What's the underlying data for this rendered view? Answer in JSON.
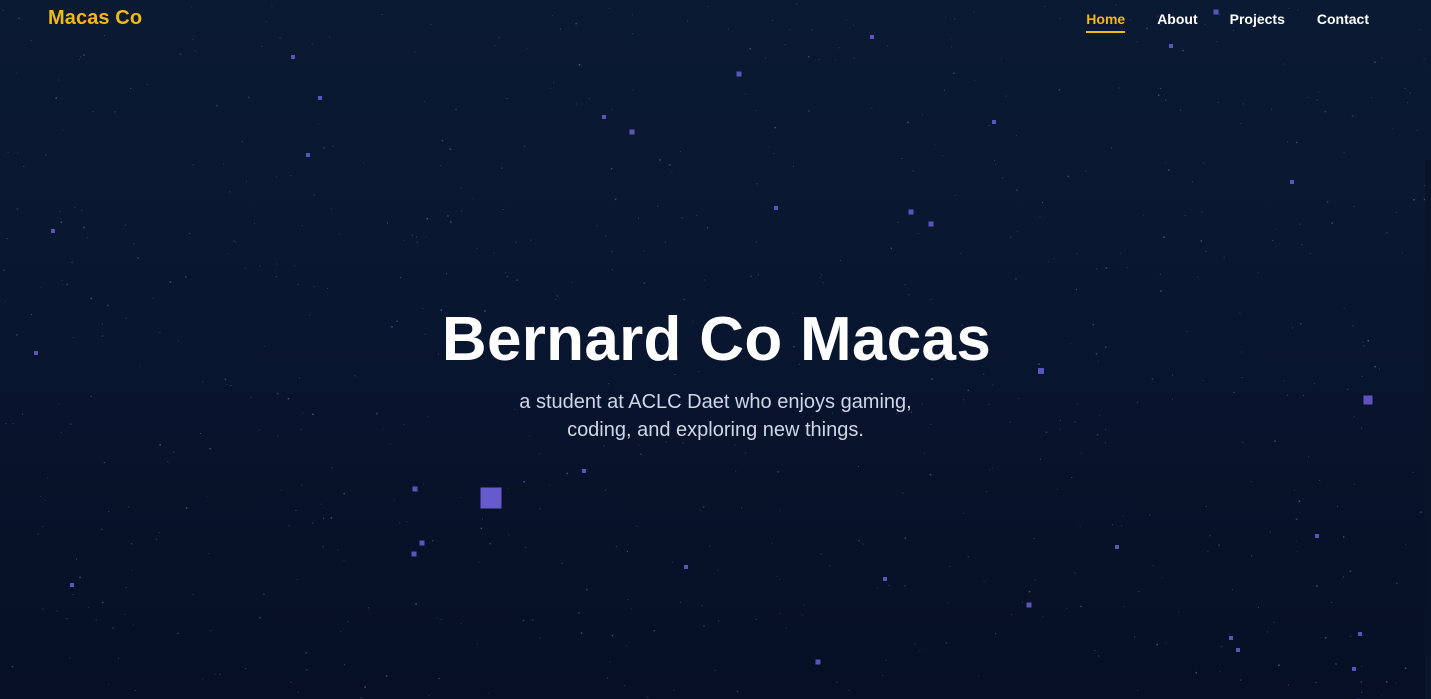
{
  "header": {
    "brand": "Macas Co",
    "nav": [
      {
        "label": "Home",
        "active": true
      },
      {
        "label": "About",
        "active": false
      },
      {
        "label": "Projects",
        "active": false
      },
      {
        "label": "Contact",
        "active": false
      }
    ]
  },
  "hero": {
    "title": "Bernard Co Macas",
    "subtitle": "a student at ACLC Daet who enjoys gaming, coding, and exploring new things."
  },
  "colors": {
    "background_top": "#0b1a33",
    "background_bottom": "#060f24",
    "accent": "#f5b712",
    "particle": "#6b5fd6",
    "dust": "#4a6a9a"
  }
}
